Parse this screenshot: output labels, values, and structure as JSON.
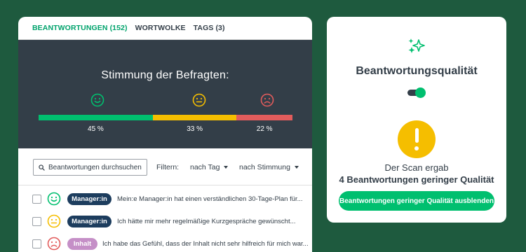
{
  "tabs": [
    {
      "label": "BEANTWORTUNGEN (152)",
      "active": true
    },
    {
      "label": "WORTWOLKE",
      "active": false
    },
    {
      "label": "TAGS (3)",
      "active": false
    }
  ],
  "sentiment": {
    "title": "Stimmung der Befragten:",
    "segments": [
      {
        "label": "positive",
        "percent_text": "45 %",
        "value": 45,
        "color": "#00bf6f"
      },
      {
        "label": "neutral",
        "percent_text": "33 %",
        "value": 33,
        "color": "#f5be00"
      },
      {
        "label": "negative",
        "percent_text": "22 %",
        "value": 22,
        "color": "#e25c5c"
      }
    ]
  },
  "toolbar": {
    "search_text": "Beantwortungen durchsuchen",
    "filter_label": "Filtern:",
    "filter_tag": "nach Tag",
    "filter_sentiment": "nach Stimmung"
  },
  "responses": [
    {
      "sentiment": "positive",
      "tag": "Manager:in",
      "text": "Mein:e Manager:in hat einen verständlichen 30-Tage-Plan für..."
    },
    {
      "sentiment": "neutral",
      "tag": "Manager:in",
      "text": "Ich hätte mir mehr regelmäßige Kurzgespräche gewünscht..."
    },
    {
      "sentiment": "negative",
      "tag": "Inhalt",
      "text": "Ich habe das Gefühl, dass der Inhalt nicht sehr hilfreich für mich war..."
    }
  ],
  "quality": {
    "title": "Beantwortungsqualität",
    "toggle_on": true,
    "scan_line1": "Der Scan ergab",
    "scan_line2": "4 Beantwortungen geringer Qualität",
    "button_label": "Beantwortungen geringer Qualität ausblenden"
  },
  "colors": {
    "background": "#1e5a3e",
    "dark_panel": "#333e48",
    "accent_green": "#00bf6f",
    "tab_active": "#00a36c",
    "tag_manager": "#1d3d5e",
    "tag_inhalt": "#c58fc7",
    "warning": "#f5be00"
  },
  "icons": {
    "search": "search-icon",
    "sparkle": "sparkle-icon",
    "warning": "exclamation-icon",
    "faces": [
      "smiley-positive-icon",
      "smiley-neutral-icon",
      "smiley-negative-icon"
    ]
  }
}
